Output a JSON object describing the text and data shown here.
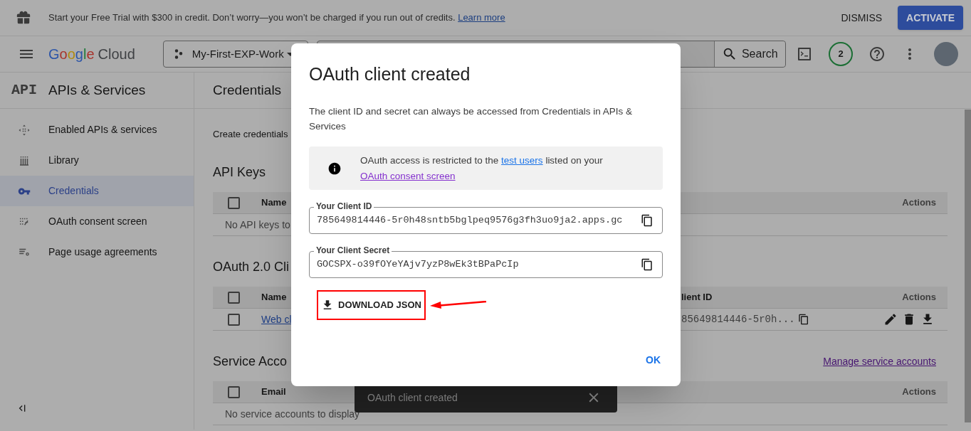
{
  "banner": {
    "text": "Start your Free Trial with $300 in credit. Don’t worry—you won’t be charged if you run out of credits.",
    "link": "Learn more",
    "buttons": [
      {
        "label": "DISMISS",
        "kind": "text"
      },
      {
        "label": "ACTIVATE",
        "kind": "filled"
      }
    ]
  },
  "top_bar": {
    "logo": {
      "brand": "Google",
      "product": "Cloud"
    },
    "project": "My-First-EXP-Work",
    "search_button": "Search",
    "notification_count": "2"
  },
  "sidebar": {
    "badge": "API",
    "title": "APIs & Services",
    "items": [
      {
        "label": "Enabled APIs & services",
        "selected": false
      },
      {
        "label": "Library",
        "selected": false
      },
      {
        "label": "Credentials",
        "selected": true
      },
      {
        "label": "OAuth consent screen",
        "selected": false
      },
      {
        "label": "Page usage agreements",
        "selected": false
      }
    ]
  },
  "main": {
    "title": "Credentials",
    "create_link": "Create credentials",
    "sections": [
      {
        "heading": "API Keys",
        "columns": [
          {
            "label": "Name",
            "kind": "name"
          },
          {
            "label": "Actions",
            "kind": "actions"
          }
        ],
        "header_checked": false,
        "empty_text": "No API keys to"
      },
      {
        "heading": "OAuth 2.0 Cli",
        "columns": [
          {
            "label": "Name",
            "kind": "name"
          },
          {
            "label": "lient ID",
            "kind": "client_id"
          },
          {
            "label": "Actions",
            "kind": "actions"
          }
        ],
        "header_checked": false,
        "rows": [
          {
            "name": "Web cl",
            "client_id": "85649814446-5r0h...",
            "checked": false
          }
        ]
      },
      {
        "heading": "Service Acco",
        "link": "Manage service accounts",
        "columns": [
          {
            "label": "Email",
            "kind": "name"
          },
          {
            "label": "Actions",
            "kind": "actions"
          }
        ],
        "header_checked": false,
        "empty_text": "No service accounts to display"
      }
    ]
  },
  "dialog": {
    "title": "OAuth client created",
    "description": "The client ID and secret can always be accessed from Credentials in APIs & Services",
    "notice": [
      {
        "text": "OAuth access is restricted to the ",
        "kind": "plain"
      },
      {
        "text": "test users",
        "kind": "link"
      },
      {
        "text": " listed on your ",
        "kind": "plain"
      },
      {
        "text": "OAuth consent screen",
        "kind": "visited_link"
      }
    ],
    "fields": [
      {
        "label": "Your Client ID",
        "value": "785649814446-5r0h48sntb5bglpeq9576g3fh3uo9ja2.apps.gc"
      },
      {
        "label": "Your Client Secret",
        "value": "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"
      }
    ],
    "download_button": "DOWNLOAD JSON",
    "ok_button": "OK"
  },
  "snackbar": {
    "text": "OAuth client created"
  }
}
